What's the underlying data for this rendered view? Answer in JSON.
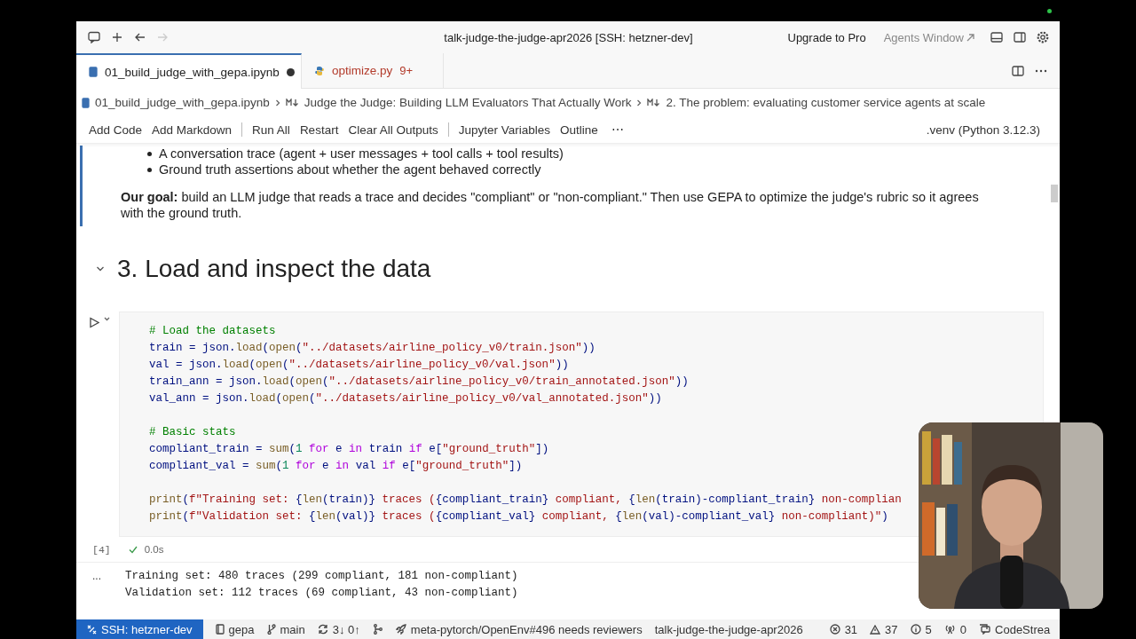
{
  "title_bar": {
    "title": "talk-judge-the-judge-apr2026 [SSH: hetzner-dev]",
    "upgrade": "Upgrade to Pro",
    "agents_window": "Agents Window"
  },
  "tabs": [
    {
      "label": "01_build_judge_with_gepa.ipynb",
      "kind": "notebook",
      "selected": true,
      "dirty": true
    },
    {
      "label": "optimize.py",
      "kind": "python",
      "selected": false,
      "dirty": false,
      "problems": "9+"
    }
  ],
  "breadcrumbs": [
    {
      "label": "01_build_judge_with_gepa.ipynb",
      "kind": "notebook"
    },
    {
      "label": "Judge the Judge: Building LLM Evaluators That Actually Work",
      "kind": "markdown"
    },
    {
      "label": "2. The problem: evaluating customer service agents at scale",
      "kind": "markdown"
    }
  ],
  "toolbar": {
    "groups": [
      [
        "Add Code",
        "Add Markdown"
      ],
      [
        "Run All",
        "Restart",
        "Clear All Outputs"
      ],
      [
        "Jupyter Variables",
        "Outline"
      ]
    ],
    "more": "⋯",
    "kernel": ".venv (Python 3.12.3)"
  },
  "notebook": {
    "markdown_cell": {
      "bullets": [
        "A conversation trace (agent + user messages + tool calls + tool results)",
        "Ground truth assertions about whether the agent behaved correctly"
      ],
      "goal": "**Our goal:** build an LLM judge that reads a trace and decides \"compliant\" or \"non-compliant.\" Then use GEPA to optimize the judge's rubric so it agrees with the ground truth."
    },
    "heading": {
      "text": "3. Load and inspect the data",
      "expanded": true
    },
    "code_cell": {
      "execution_count": "[4]",
      "status": "0.0s",
      "succeeded": true,
      "blocks": [
        [
          [
            {
              "kind": "com",
              "text": "# Load the datasets"
            }
          ],
          [
            {
              "kind": "var",
              "text": "train = json."
            },
            {
              "kind": "fn",
              "text": "load"
            },
            {
              "kind": "var",
              "text": "("
            },
            {
              "kind": "fn",
              "text": "open"
            },
            {
              "kind": "var",
              "text": "("
            },
            {
              "kind": "str",
              "text": "\"../datasets/airline_policy_v0/train.json\""
            },
            {
              "kind": "var",
              "text": "))"
            }
          ],
          [
            {
              "kind": "var",
              "text": "val = json."
            },
            {
              "kind": "fn",
              "text": "load"
            },
            {
              "kind": "var",
              "text": "("
            },
            {
              "kind": "fn",
              "text": "open"
            },
            {
              "kind": "var",
              "text": "("
            },
            {
              "kind": "str",
              "text": "\"../datasets/airline_policy_v0/val.json\""
            },
            {
              "kind": "var",
              "text": "))"
            }
          ],
          [
            {
              "kind": "var",
              "text": "train_ann = json."
            },
            {
              "kind": "fn",
              "text": "load"
            },
            {
              "kind": "var",
              "text": "("
            },
            {
              "kind": "fn",
              "text": "open"
            },
            {
              "kind": "var",
              "text": "("
            },
            {
              "kind": "str",
              "text": "\"../datasets/airline_policy_v0/train_annotated.json\""
            },
            {
              "kind": "var",
              "text": "))"
            }
          ],
          [
            {
              "kind": "var",
              "text": "val_ann = json."
            },
            {
              "kind": "fn",
              "text": "load"
            },
            {
              "kind": "var",
              "text": "("
            },
            {
              "kind": "fn",
              "text": "open"
            },
            {
              "kind": "var",
              "text": "("
            },
            {
              "kind": "str",
              "text": "\"../datasets/airline_policy_v0/val_annotated.json\""
            },
            {
              "kind": "var",
              "text": "))"
            }
          ]
        ],
        [
          [
            {
              "kind": "com",
              "text": "# Basic stats"
            }
          ],
          [
            {
              "kind": "var",
              "text": "compliant_train = "
            },
            {
              "kind": "fn",
              "text": "sum"
            },
            {
              "kind": "var",
              "text": "("
            },
            {
              "kind": "num",
              "text": "1"
            },
            {
              "kind": "kw",
              "text": " for"
            },
            {
              "kind": "var",
              "text": " e "
            },
            {
              "kind": "kw",
              "text": "in"
            },
            {
              "kind": "var",
              "text": " train "
            },
            {
              "kind": "kw",
              "text": "if"
            },
            {
              "kind": "var",
              "text": " e["
            },
            {
              "kind": "str",
              "text": "\"ground_truth\""
            },
            {
              "kind": "var",
              "text": "])"
            }
          ],
          [
            {
              "kind": "var",
              "text": "compliant_val = "
            },
            {
              "kind": "fn",
              "text": "sum"
            },
            {
              "kind": "var",
              "text": "("
            },
            {
              "kind": "num",
              "text": "1"
            },
            {
              "kind": "kw",
              "text": " for"
            },
            {
              "kind": "var",
              "text": " e "
            },
            {
              "kind": "kw",
              "text": "in"
            },
            {
              "kind": "var",
              "text": " val "
            },
            {
              "kind": "kw",
              "text": "if"
            },
            {
              "kind": "var",
              "text": " e["
            },
            {
              "kind": "str",
              "text": "\"ground_truth\""
            },
            {
              "kind": "var",
              "text": "])"
            }
          ]
        ],
        [
          [
            {
              "kind": "fn",
              "text": "print"
            },
            {
              "kind": "var",
              "text": "("
            },
            {
              "kind": "str",
              "text": "f\"Training set: "
            },
            {
              "kind": "var",
              "text": "{"
            },
            {
              "kind": "fn",
              "text": "len"
            },
            {
              "kind": "var",
              "text": "(train)}"
            },
            {
              "kind": "str",
              "text": " traces ("
            },
            {
              "kind": "var",
              "text": "{compliant_train}"
            },
            {
              "kind": "str",
              "text": " compliant, "
            },
            {
              "kind": "var",
              "text": "{"
            },
            {
              "kind": "fn",
              "text": "len"
            },
            {
              "kind": "var",
              "text": "(train)-compliant_train}"
            },
            {
              "kind": "str",
              "text": " non-complian"
            }
          ],
          [
            {
              "kind": "fn",
              "text": "print"
            },
            {
              "kind": "var",
              "text": "("
            },
            {
              "kind": "str",
              "text": "f\"Validation set: "
            },
            {
              "kind": "var",
              "text": "{"
            },
            {
              "kind": "fn",
              "text": "len"
            },
            {
              "kind": "var",
              "text": "(val)}"
            },
            {
              "kind": "str",
              "text": " traces ("
            },
            {
              "kind": "var",
              "text": "{compliant_val}"
            },
            {
              "kind": "str",
              "text": " compliant, "
            },
            {
              "kind": "var",
              "text": "{"
            },
            {
              "kind": "fn",
              "text": "len"
            },
            {
              "kind": "var",
              "text": "(val)-compliant_val}"
            },
            {
              "kind": "str",
              "text": " non-compliant)\""
            },
            {
              "kind": "var",
              "text": ")"
            }
          ]
        ]
      ],
      "output_more": "...",
      "output_lines": [
        "Training set: 480 traces (299 compliant, 181 non-compliant)",
        "Validation set: 112 traces (69 compliant, 43 non-compliant)"
      ]
    }
  },
  "status_bar": [
    {
      "kind": "remote",
      "text": "SSH: hetzner-dev"
    },
    {
      "kind": "folder",
      "text": "gepa"
    },
    {
      "kind": "branch",
      "text": "main"
    },
    {
      "kind": "sync",
      "text": "3↓ 0↑"
    },
    {
      "kind": "graph"
    },
    {
      "kind": "pr",
      "text": "meta-pytorch/OpenEnv#496 needs reviewers"
    },
    {
      "kind": "plain",
      "text": "talk-judge-the-judge-apr2026"
    },
    {
      "kind": "errors",
      "text": "31"
    },
    {
      "kind": "warnings",
      "text": "37"
    },
    {
      "kind": "info",
      "text": "5"
    },
    {
      "kind": "ports",
      "text": "0"
    },
    {
      "kind": "codestream",
      "text": "CodeStrea"
    }
  ]
}
